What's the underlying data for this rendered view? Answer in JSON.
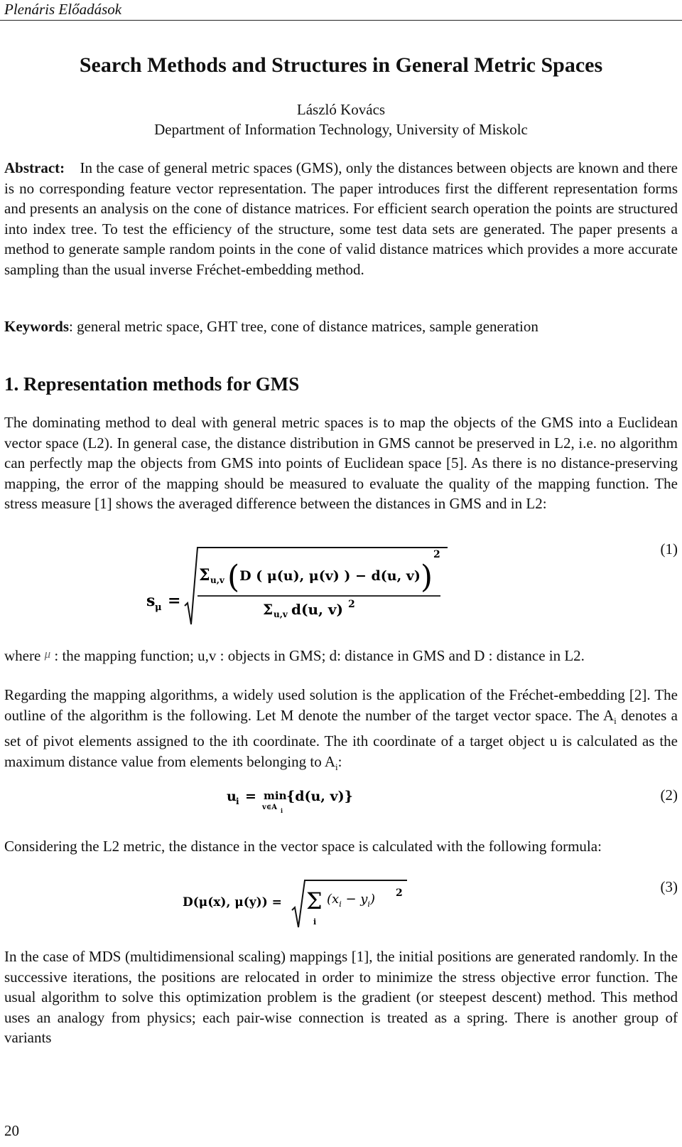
{
  "running_header": "Plenáris Előadások",
  "title": "Search Methods and Structures in General Metric Spaces",
  "author": "László Kovács",
  "affiliation": "Department of Information Technology, University of Miskolc",
  "abstract": {
    "label": "Abstract:",
    "text": "In the case of general metric spaces (GMS), only the distances between objects are known and there is no corresponding feature vector representation. The paper introduces first the different representation forms and presents an analysis on the cone of distance matrices. For efficient search operation the points are structured into index tree. To test the efficiency of the structure, some test data sets are generated. The paper presents a method to generate sample random points in the cone of valid distance matrices which provides a more accurate sampling than the usual inverse Fréchet-embedding method."
  },
  "keywords": {
    "label": "Keywords",
    "text": ":  general metric space, GHT tree, cone of distance matrices, sample generation"
  },
  "section1": {
    "heading": "1. Representation methods for GMS",
    "para1": "The dominating method to deal with general metric spaces is to map the objects of the GMS into a Euclidean vector space (L2). In general case, the distance distribution in GMS cannot be preserved in L2, i.e. no algorithm can perfectly map the objects from GMS into points of Euclidean space [5]. As there is no distance-preserving mapping, the error of the mapping should be measured to evaluate the quality of the mapping function. The stress measure [1] shows the averaged difference between the distances in GMS and in L2:",
    "eq1": {
      "lhs": "s",
      "lhs_sub": "μ",
      "eq": "=",
      "num_sum": "Σ",
      "num_sum_sub": "u,v",
      "num_body": "D ( μ(u), μ(v) ) − d(u, v)",
      "num_exp": "2",
      "den_sum": "Σ",
      "den_sum_sub": "u,v",
      "den_body": "d(u, v)",
      "den_exp": "2",
      "number": "(1)"
    },
    "where_prefix": "where",
    "where_mu": "μ",
    "where_text": ": the mapping function;  u,v : objects in GMS; d: distance in GMS and D : distance in L2.",
    "para2_a": "Regarding the mapping algorithms, a widely used solution is the application of the Fréchet-embedding [2]. The outline of the algorithm is the following. Let M denote the number of the target vector space. The A",
    "para2_sub1": "i",
    "para2_b": " denotes a set of pivot elements assigned to the ith coordinate. The ith coordinate of a target object u is calculated as the maximum distance value from elements belonging to A",
    "para2_sub2": "i",
    "para2_c": ":",
    "eq2": {
      "lhs": "u",
      "lhs_sub": "i",
      "eq": "=",
      "op": "min",
      "op_sub": "v∈A",
      "op_sub_sub": "i",
      "body": "{d(u, v)}",
      "number": "(2)"
    },
    "para3": "Considering the L2 metric, the distance in the vector space is calculated with the following formula:",
    "eq3": {
      "lhs": "D(μ(x), μ(y)) =",
      "sum": "Σ",
      "sum_sub": "i",
      "body": "(x",
      "sub1": "i",
      "mid": " − y",
      "sub2": "i",
      "close": ")",
      "exp": "2",
      "number": "(3)"
    },
    "para4": "In the case of MDS (multidimensional scaling) mappings [1], the initial positions are generated randomly. In the successive iterations, the positions are relocated in order to minimize the stress objective error function. The usual algorithm to solve this optimization problem is the gradient (or steepest descent) method. This method uses an analogy from physics; each pair-wise connection is treated as a spring. There is another group of variants"
  },
  "page_number": "20"
}
